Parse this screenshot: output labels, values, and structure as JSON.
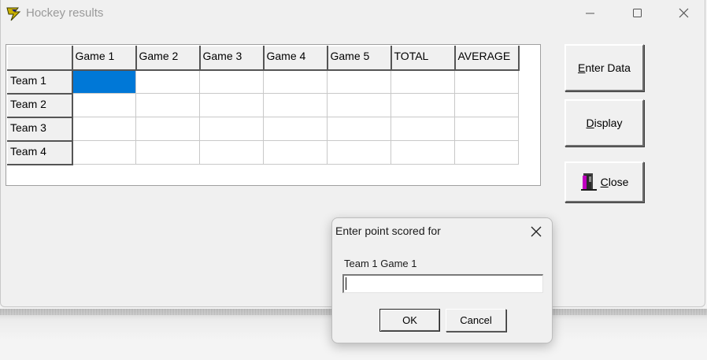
{
  "window": {
    "title": "Hockey results",
    "controls": {
      "minimize": "minimize-icon",
      "maximize": "maximize-icon",
      "close": "close-icon"
    }
  },
  "grid": {
    "columns": [
      "Game 1",
      "Game 2",
      "Game 3",
      "Game 4",
      "Game 5",
      "TOTAL",
      "AVERAGE"
    ],
    "rows": [
      {
        "label": "Team 1",
        "cells": [
          "",
          "",
          "",
          "",
          "",
          "",
          ""
        ]
      },
      {
        "label": "Team 2",
        "cells": [
          "",
          "",
          "",
          "",
          "",
          "",
          ""
        ]
      },
      {
        "label": "Team 3",
        "cells": [
          "",
          "",
          "",
          "",
          "",
          "",
          ""
        ]
      },
      {
        "label": "Team 4",
        "cells": [
          "",
          "",
          "",
          "",
          "",
          "",
          ""
        ]
      }
    ],
    "selected_color": "#0078d7"
  },
  "buttons": {
    "enter_data": {
      "accel": "E",
      "rest": "nter Data"
    },
    "display": {
      "accel": "D",
      "rest": "isplay"
    },
    "close": {
      "accel": "C",
      "rest": "lose",
      "icon": "door-exit-icon"
    }
  },
  "dialog": {
    "title": "Enter point scored for",
    "prompt": "Team 1 Game 1",
    "input_value": "",
    "ok_label": "OK",
    "cancel_label": "Cancel",
    "close_icon": "close-icon"
  }
}
